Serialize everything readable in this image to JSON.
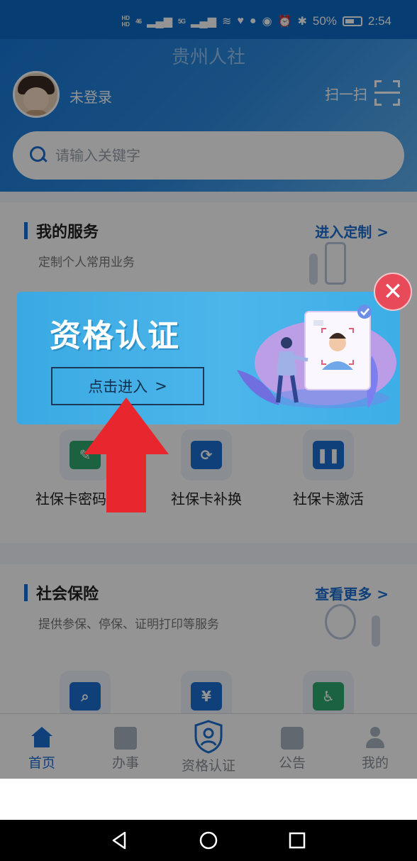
{
  "status_bar": {
    "time": "2:54",
    "battery": "50%",
    "network_hd": "HD",
    "signal_4g": "46",
    "signal_5g": "5G"
  },
  "header": {
    "app_title": "贵州人社",
    "login_status": "未登录",
    "scan_label": "扫一扫"
  },
  "search": {
    "placeholder": "请输入关键字"
  },
  "my_services": {
    "title": "我的服务",
    "subtitle": "定制个人常用业务",
    "link": "进入定制 >",
    "items": [
      {
        "label": "社保卡密码修改",
        "icon": "pencil-icon",
        "color": "#2eaa6e"
      },
      {
        "label": "社保卡补换",
        "icon": "refresh-icon",
        "color": "#1d6fd1"
      },
      {
        "label": "社保卡激活",
        "icon": "pause-icon",
        "color": "#1d6fd1"
      }
    ]
  },
  "social_insurance": {
    "title": "社会保险",
    "subtitle": "提供参保、停保、证明打印等服务",
    "link": "查看更多 >",
    "items": [
      {
        "icon": "search-icon",
        "color": "#1d6fd1"
      },
      {
        "icon": "yuan-icon",
        "color": "#1d6fd1"
      },
      {
        "icon": "accessibility-icon",
        "color": "#2eaa6e"
      }
    ]
  },
  "tabs": [
    {
      "label": "首页",
      "icon": "home-icon",
      "active": true
    },
    {
      "label": "办事",
      "icon": "edit-icon",
      "active": false
    },
    {
      "label": "资格认证",
      "icon": "shield-user-icon",
      "active": false
    },
    {
      "label": "公告",
      "icon": "notice-icon",
      "active": false
    },
    {
      "label": "我的",
      "icon": "user-icon",
      "active": false
    }
  ],
  "popup": {
    "title": "资格认证",
    "button_label": "点击进入",
    "button_chevron": ">",
    "close_symbol": "✕"
  },
  "colors": {
    "brand_blue": "#1d6fd1",
    "popup_bg": "#3aa9e3",
    "close_red": "#e84a5a",
    "arrow_red": "#e8262e"
  }
}
